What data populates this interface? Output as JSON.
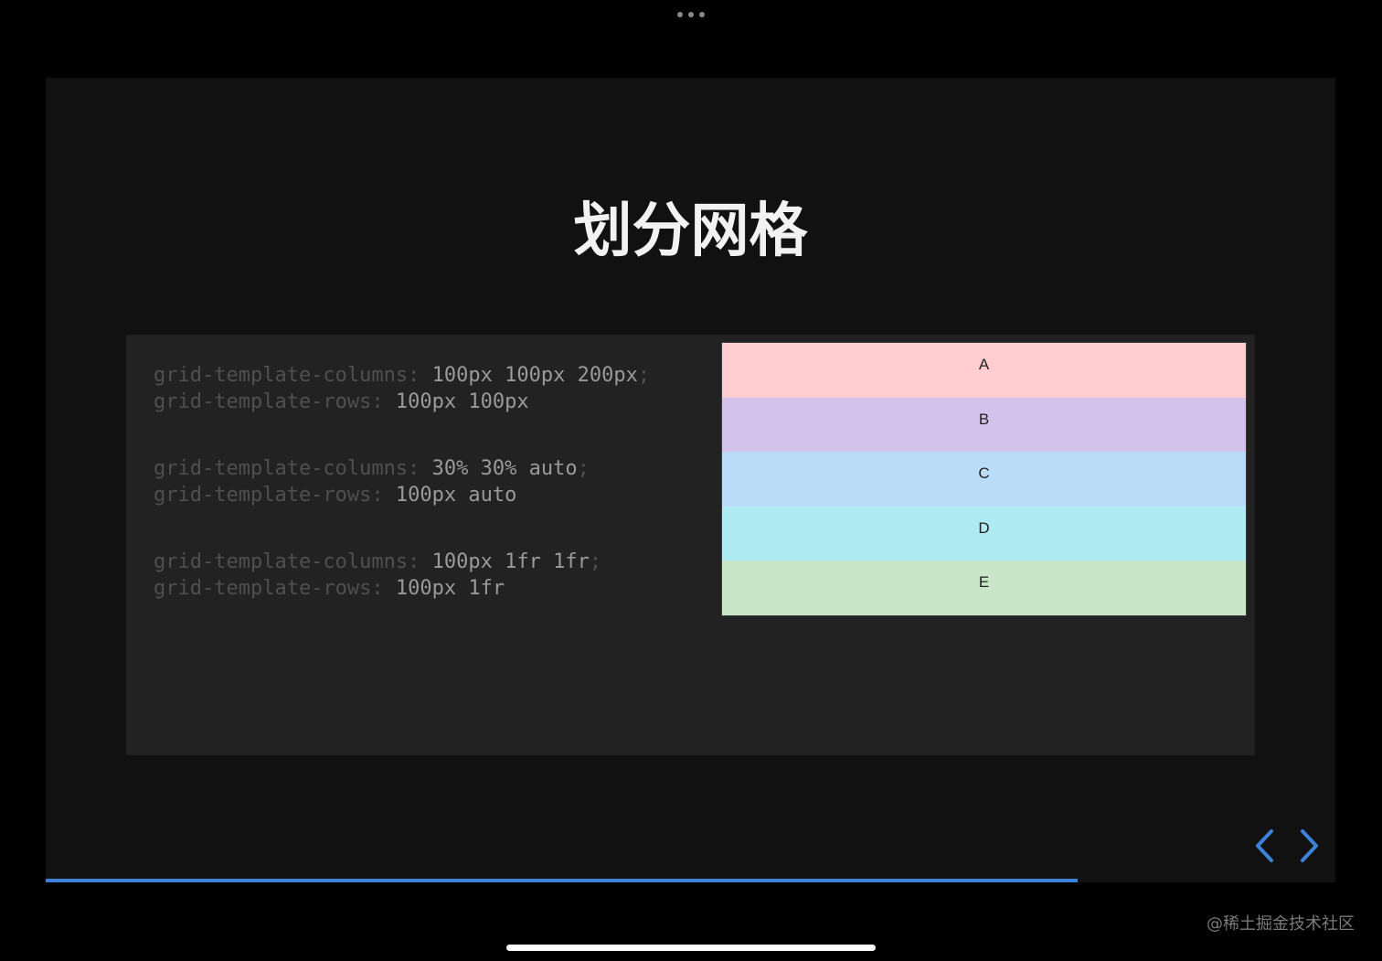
{
  "slide": {
    "title": "划分网格",
    "progress_percent": 80
  },
  "code_blocks": [
    {
      "lines": [
        {
          "prop": "grid-template-columns:",
          "val": " 100px 100px 200px",
          "end": ";"
        },
        {
          "prop": "grid-template-rows:",
          "val": " 100px 100px",
          "end": ""
        }
      ]
    },
    {
      "lines": [
        {
          "prop": "grid-template-columns:",
          "val": " 30% 30% auto",
          "end": ";"
        },
        {
          "prop": "grid-template-rows:",
          "val": " 100px auto",
          "end": ""
        }
      ]
    },
    {
      "lines": [
        {
          "prop": "grid-template-columns:",
          "val": " 100px 1fr 1fr",
          "end": ";"
        },
        {
          "prop": "grid-template-rows:",
          "val": " 100px 1fr",
          "end": ""
        }
      ]
    }
  ],
  "grid_cells": [
    {
      "label": "A",
      "color": "#ffcccf"
    },
    {
      "label": "B",
      "color": "#d3c2ea"
    },
    {
      "label": "C",
      "color": "#badcf8"
    },
    {
      "label": "D",
      "color": "#aeebf2"
    },
    {
      "label": "E",
      "color": "#c9e6c9"
    }
  ],
  "navigation": {
    "prev_icon": "chevron-left-icon",
    "next_icon": "chevron-right-icon",
    "accent_color": "#3b82d8"
  },
  "watermark": "@稀土掘金技术社区"
}
